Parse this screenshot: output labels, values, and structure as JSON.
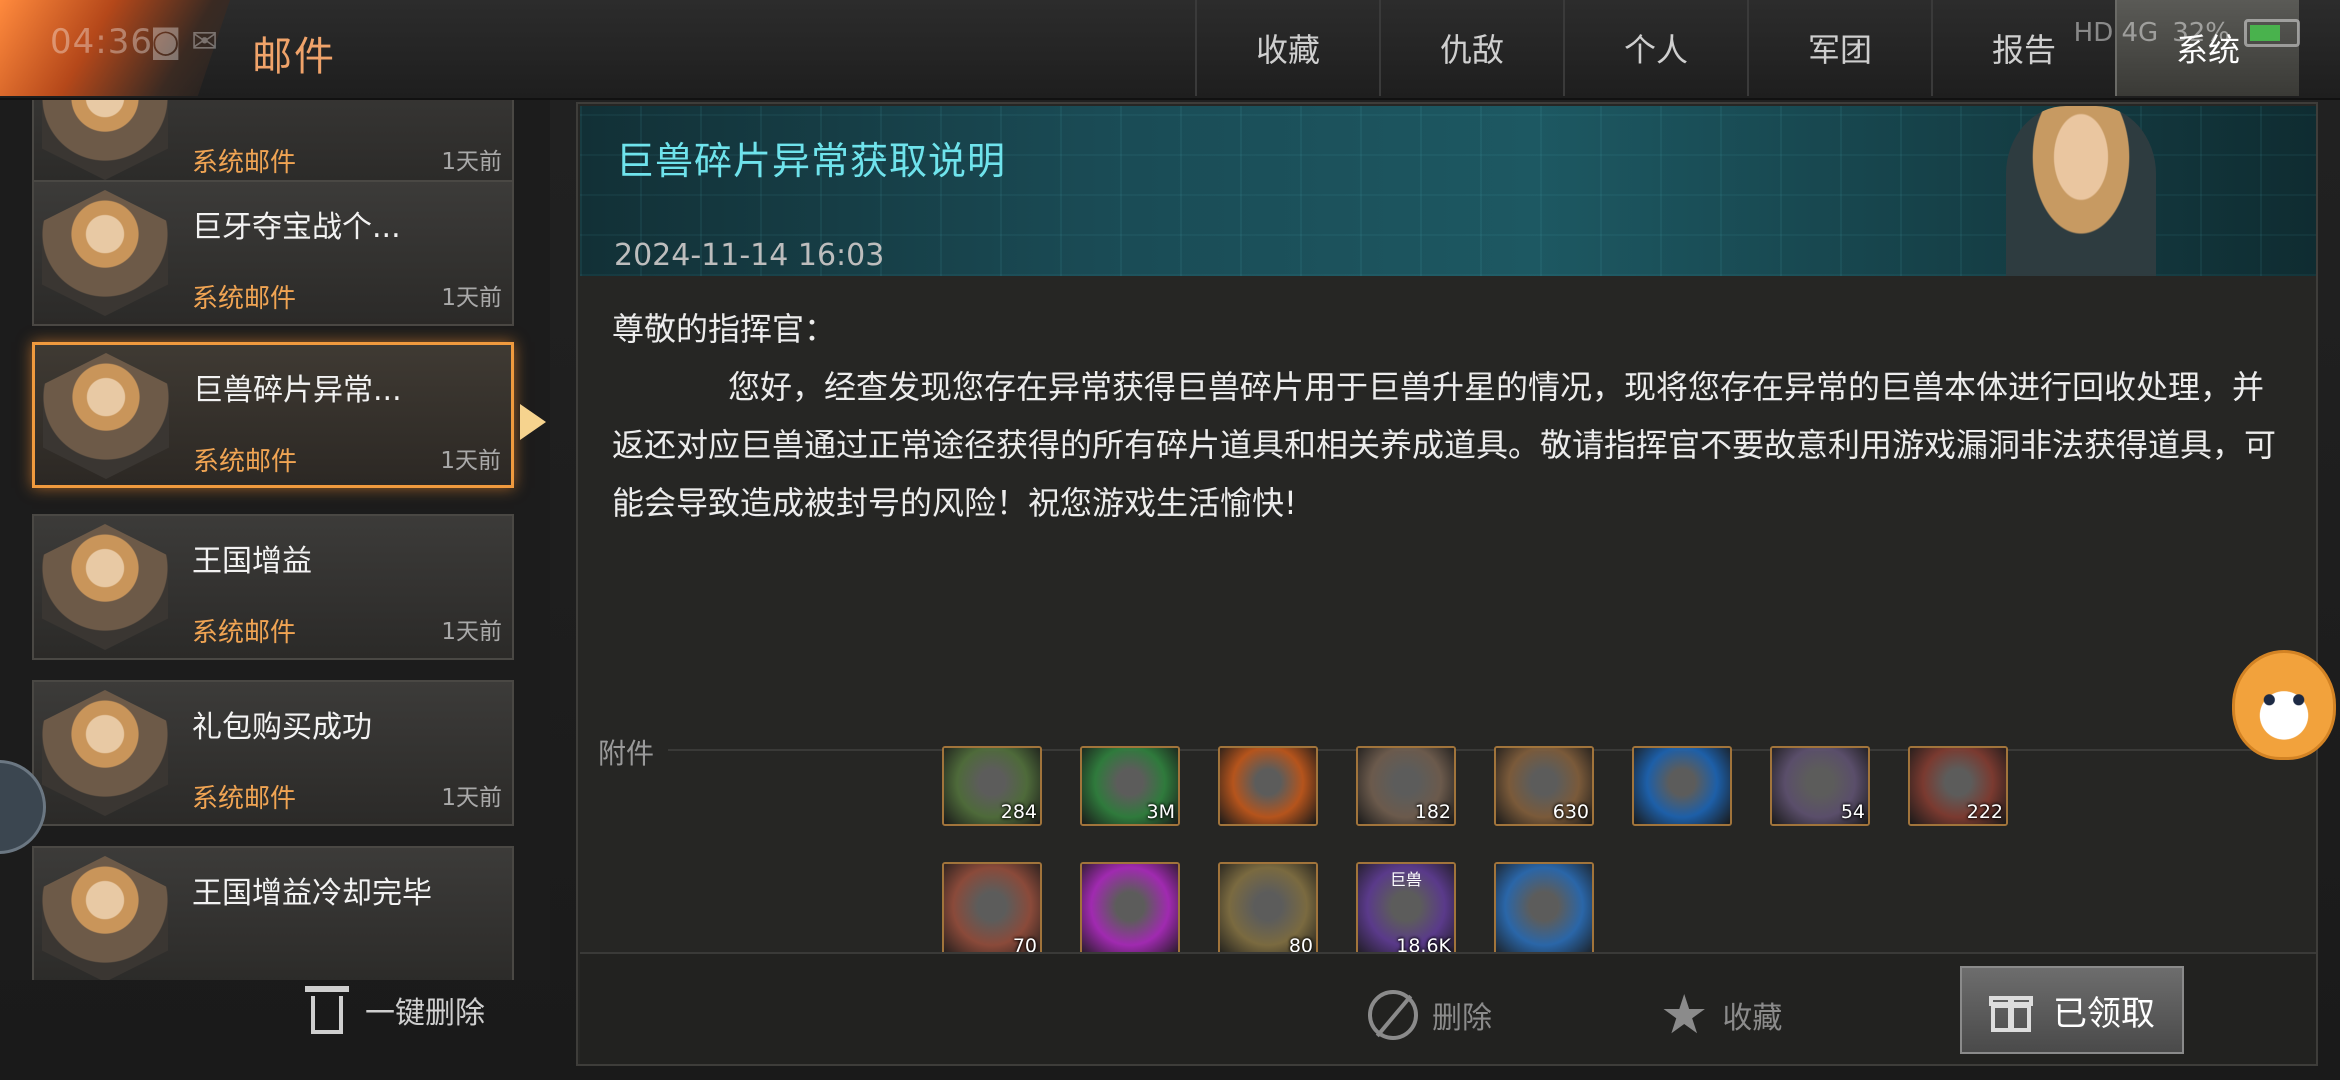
{
  "status_bar": {
    "time": "04:36",
    "icons": "◙ ✉",
    "network": "HD 4G",
    "battery": "32%"
  },
  "header": {
    "title": "邮件",
    "tabs": [
      {
        "label": "收藏",
        "active": false
      },
      {
        "label": "仇敌",
        "active": false
      },
      {
        "label": "个人",
        "active": false
      },
      {
        "label": "军团",
        "active": false
      },
      {
        "label": "报告",
        "active": false
      },
      {
        "label": "系统",
        "active": true
      }
    ]
  },
  "mail_list": {
    "items": [
      {
        "subject": "",
        "sender": "系统邮件",
        "time": "1天前"
      },
      {
        "subject": "巨牙夺宝战个...",
        "sender": "系统邮件",
        "time": "1天前"
      },
      {
        "subject": "巨兽碎片异常...",
        "sender": "系统邮件",
        "time": "1天前",
        "selected": true
      },
      {
        "subject": "王国增益",
        "sender": "系统邮件",
        "time": "1天前"
      },
      {
        "subject": "礼包购买成功",
        "sender": "系统邮件",
        "time": "1天前"
      },
      {
        "subject": "王国增益冷却完毕",
        "sender": "",
        "time": ""
      }
    ],
    "delete_all_label": "一键删除"
  },
  "detail": {
    "title": "巨兽碎片异常获取说明",
    "date": "2024-11-14  16:03",
    "greeting": "尊敬的指挥官：",
    "body": "您好，经查发现您存在异常获得巨兽碎片用于巨兽升星的情况，现将您存在异常的巨兽本体进行回收处理，并返还对应巨兽通过正常途径获得的所有碎片道具和相关养成道具。敬请指挥官不要故意利用游戏漏洞非法获得道具，可能会导致造成被封号的风险！祝您游戏生活愉快!",
    "attachments_label": "附件",
    "attachments": [
      {
        "icon": "green-dinosaur-fragment",
        "qty": "284",
        "color": "#4e6a3a"
      },
      {
        "icon": "raw-meat",
        "qty": "3M",
        "color": "#2f7a3c"
      },
      {
        "icon": "fire-emblem",
        "qty": "",
        "color": "#b5541c"
      },
      {
        "icon": "grey-dinosaur-fragment",
        "qty": "182",
        "color": "#6b5a4c"
      },
      {
        "icon": "brown-dinosaur-fragment",
        "qty": "630",
        "color": "#7a5a3a"
      },
      {
        "icon": "blue-wave-emblem",
        "qty": "",
        "color": "#1d5fa8"
      },
      {
        "icon": "red-dinosaur-fragment",
        "qty": "54",
        "color": "#5a4e6a"
      },
      {
        "icon": "gorilla-fragment",
        "qty": "222",
        "color": "#7a3a30"
      },
      {
        "icon": "red-helmet-dino-fragment",
        "qty": "70",
        "color": "#8a4a3a"
      },
      {
        "icon": "racing-badge",
        "qty": "",
        "color": "#a02ab0"
      },
      {
        "icon": "potion-bottle",
        "qty": "80",
        "color": "#7a6a40"
      },
      {
        "icon": "beast-tank",
        "qty": "18.6K",
        "tag": "巨兽",
        "color": "#5a3a8a"
      },
      {
        "icon": "lightning-crack-emblem",
        "qty": "",
        "color": "#2a66a8"
      }
    ],
    "actions": {
      "delete_label": "删除",
      "favorite_label": "收藏",
      "claimed_label": "已领取"
    }
  }
}
